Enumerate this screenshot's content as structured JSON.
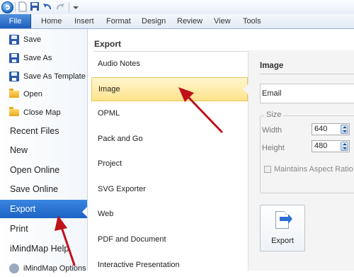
{
  "ribbon": {
    "tabs": [
      "File",
      "Home",
      "Insert",
      "Format",
      "Design",
      "Review",
      "View",
      "Tools"
    ]
  },
  "backstage": {
    "small_items": [
      {
        "label": "Save",
        "icon": "save-icon"
      },
      {
        "label": "Save As",
        "icon": "save-as-icon"
      },
      {
        "label": "Save As Template",
        "icon": "save-template-icon"
      },
      {
        "label": "Open",
        "icon": "open-folder-icon"
      },
      {
        "label": "Close Map",
        "icon": "close-map-folder-icon"
      }
    ],
    "big_items": [
      "Recent Files",
      "New",
      "Open Online",
      "Save Online",
      "Export",
      "Print",
      "iMindMap Help",
      "iMindMap Options"
    ],
    "selected": "Export"
  },
  "export": {
    "heading": "Export",
    "items": [
      "Audio Notes",
      "Image",
      "OPML",
      "Pack and Go",
      "Project",
      "SVG Exporter",
      "Web",
      "PDF and Document",
      "Interactive Presentation"
    ],
    "selected": "Image"
  },
  "image_panel": {
    "heading": "Image",
    "format_value": "Email",
    "size_legend": "Size",
    "width_label": "Width",
    "width_value": "640",
    "height_label": "Height",
    "height_value": "480",
    "aspect_label": "Maintains Aspect Ratio",
    "export_button_label": "Export"
  },
  "colors": {
    "file_tab": "#1e5fbf",
    "selected_nav": "#1d63c4",
    "selected_item": "#ffe38c",
    "annotation_arrow": "#c0121a"
  }
}
